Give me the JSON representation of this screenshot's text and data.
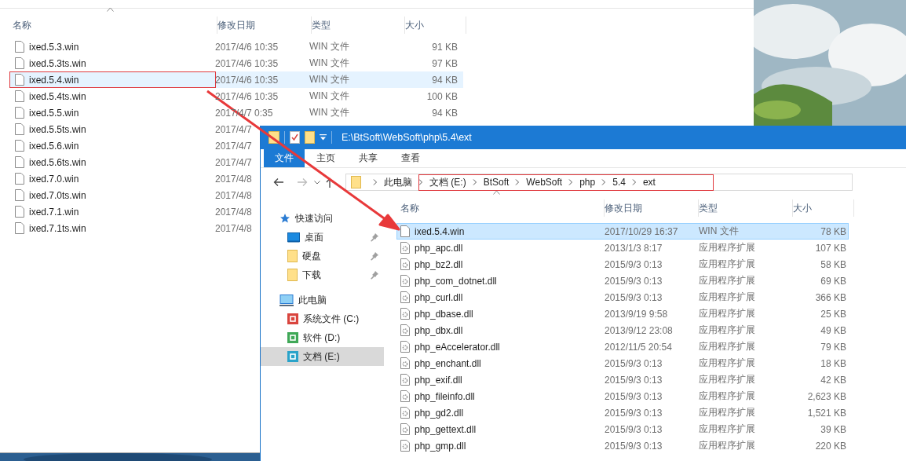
{
  "back_window": {
    "columns": [
      {
        "label": "名称",
        "sorted": true
      },
      {
        "label": "修改日期",
        "sorted": false
      },
      {
        "label": "类型",
        "sorted": false
      },
      {
        "label": "大小",
        "sorted": false
      }
    ],
    "rows": [
      {
        "name": "ixed.5.3.win",
        "modified": "2017/4/6 10:35",
        "type": "WIN 文件",
        "size": "91 KB",
        "selected": false
      },
      {
        "name": "ixed.5.3ts.win",
        "modified": "2017/4/6 10:35",
        "type": "WIN 文件",
        "size": "97 KB",
        "selected": false
      },
      {
        "name": "ixed.5.4.win",
        "modified": "2017/4/6 10:35",
        "type": "WIN 文件",
        "size": "94 KB",
        "selected": true
      },
      {
        "name": "ixed.5.4ts.win",
        "modified": "2017/4/6 10:35",
        "type": "WIN 文件",
        "size": "100 KB",
        "selected": false
      },
      {
        "name": "ixed.5.5.win",
        "modified": "2017/4/7 0:35",
        "type": "WIN 文件",
        "size": "94 KB",
        "selected": false
      },
      {
        "name": "ixed.5.5ts.win",
        "modified": "2017/4/7",
        "selected": false
      },
      {
        "name": "ixed.5.6.win",
        "modified": "2017/4/7",
        "selected": false
      },
      {
        "name": "ixed.5.6ts.win",
        "modified": "2017/4/7",
        "selected": false
      },
      {
        "name": "ixed.7.0.win",
        "modified": "2017/4/8",
        "selected": false
      },
      {
        "name": "ixed.7.0ts.win",
        "modified": "2017/4/8",
        "selected": false
      },
      {
        "name": "ixed.7.1.win",
        "modified": "2017/4/8",
        "selected": false
      },
      {
        "name": "ixed.7.1ts.win",
        "modified": "2017/4/8",
        "selected": false
      }
    ]
  },
  "front_window": {
    "title": "E:\\BtSoft\\WebSoft\\php\\5.4\\ext",
    "ribbon_tabs": [
      {
        "label": "文件",
        "selected": true
      },
      {
        "label": "主页",
        "selected": false
      },
      {
        "label": "共享",
        "selected": false
      },
      {
        "label": "查看",
        "selected": false
      }
    ],
    "breadcrumb": [
      "此电脑",
      "文档 (E:)",
      "BtSoft",
      "WebSoft",
      "php",
      "5.4",
      "ext"
    ],
    "nav": [
      {
        "label": "快速访问",
        "kind": "quick",
        "selected": false,
        "children": [
          {
            "label": "桌面",
            "kind": "desktop",
            "pinned": true,
            "selected": false
          },
          {
            "label": "硬盘",
            "kind": "folder",
            "pinned": true,
            "selected": false
          },
          {
            "label": "下载",
            "kind": "folder",
            "pinned": true,
            "selected": false
          }
        ]
      },
      {
        "label": "此电脑",
        "kind": "pc",
        "selected": false,
        "children": [
          {
            "label": "系统文件 (C:)",
            "kind": "drive",
            "color": "#d9453e",
            "selected": false
          },
          {
            "label": "软件 (D:)",
            "kind": "drive",
            "color": "#3fa857",
            "selected": false
          },
          {
            "label": "文档 (E:)",
            "kind": "drive",
            "color": "#2aa3c9",
            "selected": true
          }
        ]
      }
    ],
    "columns": [
      {
        "label": "名称",
        "sorted": true
      },
      {
        "label": "修改日期",
        "sorted": false
      },
      {
        "label": "类型",
        "sorted": false
      },
      {
        "label": "大小",
        "sorted": false
      }
    ],
    "rows": [
      {
        "name": "ixed.5.4.win",
        "modified": "2017/10/29 16:37",
        "type": "WIN 文件",
        "size": "78 KB",
        "kind": "file",
        "selected": true
      },
      {
        "name": "php_apc.dll",
        "modified": "2013/1/3 8:17",
        "type": "应用程序扩展",
        "size": "107 KB",
        "kind": "dll",
        "selected": false
      },
      {
        "name": "php_bz2.dll",
        "modified": "2015/9/3 0:13",
        "type": "应用程序扩展",
        "size": "58 KB",
        "kind": "dll",
        "selected": false
      },
      {
        "name": "php_com_dotnet.dll",
        "modified": "2015/9/3 0:13",
        "type": "应用程序扩展",
        "size": "69 KB",
        "kind": "dll",
        "selected": false
      },
      {
        "name": "php_curl.dll",
        "modified": "2015/9/3 0:13",
        "type": "应用程序扩展",
        "size": "366 KB",
        "kind": "dll",
        "selected": false
      },
      {
        "name": "php_dbase.dll",
        "modified": "2013/9/19 9:58",
        "type": "应用程序扩展",
        "size": "25 KB",
        "kind": "dll",
        "selected": false
      },
      {
        "name": "php_dbx.dll",
        "modified": "2013/9/12 23:08",
        "type": "应用程序扩展",
        "size": "49 KB",
        "kind": "dll",
        "selected": false
      },
      {
        "name": "php_eAccelerator.dll",
        "modified": "2012/11/5 20:54",
        "type": "应用程序扩展",
        "size": "79 KB",
        "kind": "dll",
        "selected": false
      },
      {
        "name": "php_enchant.dll",
        "modified": "2015/9/3 0:13",
        "type": "应用程序扩展",
        "size": "18 KB",
        "kind": "dll",
        "selected": false
      },
      {
        "name": "php_exif.dll",
        "modified": "2015/9/3 0:13",
        "type": "应用程序扩展",
        "size": "42 KB",
        "kind": "dll",
        "selected": false
      },
      {
        "name": "php_fileinfo.dll",
        "modified": "2015/9/3 0:13",
        "type": "应用程序扩展",
        "size": "2,623 KB",
        "kind": "dll",
        "selected": false
      },
      {
        "name": "php_gd2.dll",
        "modified": "2015/9/3 0:13",
        "type": "应用程序扩展",
        "size": "1,521 KB",
        "kind": "dll",
        "selected": false
      },
      {
        "name": "php_gettext.dll",
        "modified": "2015/9/3 0:13",
        "type": "应用程序扩展",
        "size": "39 KB",
        "kind": "dll",
        "selected": false
      },
      {
        "name": "php_gmp.dll",
        "modified": "2015/9/3 0:13",
        "type": "应用程序扩展",
        "size": "220 KB",
        "kind": "dll",
        "selected": false
      }
    ]
  }
}
